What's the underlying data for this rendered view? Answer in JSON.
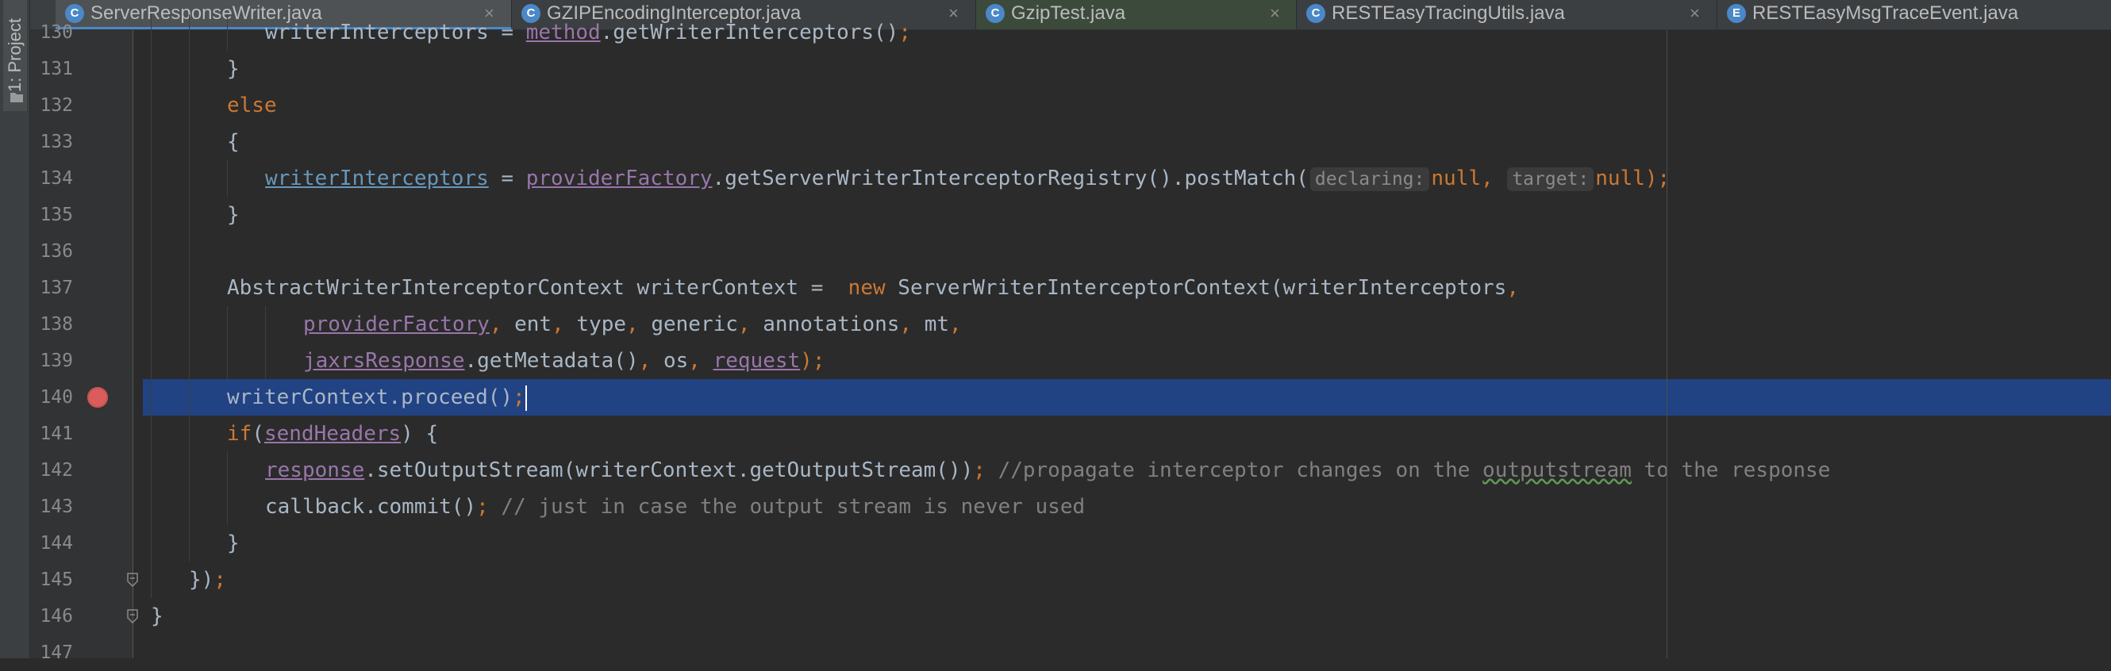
{
  "sidebar": {
    "project_label": "1: Project"
  },
  "tabs": [
    {
      "icon": "class-icon",
      "icon_letter": "C",
      "icon_color": "#4a88c7",
      "label": "ServerResponseWriter.java",
      "close": "×",
      "active": true
    },
    {
      "icon": "class-icon",
      "icon_letter": "C",
      "icon_color": "#4a88c7",
      "label": "GZIPEncodingInterceptor.java",
      "close": "×",
      "active": false
    },
    {
      "icon": "class-icon",
      "icon_letter": "C",
      "icon_color": "#4a88c7",
      "label": "GzipTest.java",
      "close": "×",
      "active": false
    },
    {
      "icon": "class-icon",
      "icon_letter": "C",
      "icon_color": "#4a88c7",
      "label": "RESTEasyTracingUtils.java",
      "close": "×",
      "active": false
    },
    {
      "icon": "enum-icon",
      "icon_letter": "E",
      "icon_color": "#4a88c7",
      "label": "RESTEasyMsgTraceEvent.java",
      "close": "",
      "active": false
    }
  ],
  "colors": {
    "background": "#2b2b2b",
    "selection": "#214283",
    "keyword": "#cc7832",
    "field": "#9876aa",
    "comment": "#808080",
    "breakpoint": "#db5c5c"
  },
  "editor": {
    "lines": [
      {
        "num": "130",
        "tokens": [
          {
            "t": "writerInterceptors = ",
            "c": "default"
          },
          {
            "t": "method",
            "c": "field"
          },
          {
            "t": ".getWriterInterceptors()",
            "c": "default"
          },
          {
            "t": ";",
            "c": "keyword"
          }
        ]
      },
      {
        "num": "131",
        "tokens": [
          {
            "t": "}",
            "c": "default"
          }
        ]
      },
      {
        "num": "132",
        "tokens": [
          {
            "t": "else",
            "c": "keyword"
          }
        ]
      },
      {
        "num": "133",
        "tokens": [
          {
            "t": "{",
            "c": "default"
          }
        ]
      },
      {
        "num": "134",
        "tokens": [
          {
            "t": "writerInterceptors",
            "c": "fieldblue"
          },
          {
            "t": " = ",
            "c": "default"
          },
          {
            "t": "providerFactory",
            "c": "field"
          },
          {
            "t": ".getServerWriterInterceptorRegistry().postMatch(",
            "c": "default"
          },
          {
            "t": "declaring:",
            "c": "hint"
          },
          {
            "t": "null",
            "c": "keyword"
          },
          {
            "t": ", ",
            "c": "keyword"
          },
          {
            "t": "target:",
            "c": "hint"
          },
          {
            "t": "null",
            "c": "keyword"
          },
          {
            "t": ");",
            "c": "keyword"
          }
        ]
      },
      {
        "num": "135",
        "tokens": [
          {
            "t": "}",
            "c": "default"
          }
        ]
      },
      {
        "num": "136",
        "tokens": []
      },
      {
        "num": "137",
        "tokens": [
          {
            "t": "AbstractWriterInterceptorContext writerContext =  ",
            "c": "default"
          },
          {
            "t": "new ",
            "c": "keyword"
          },
          {
            "t": "ServerWriterInterceptorContext(writerInterceptors",
            "c": "default"
          },
          {
            "t": ",",
            "c": "keyword"
          }
        ]
      },
      {
        "num": "138",
        "tokens": [
          {
            "t": "providerFactory",
            "c": "field"
          },
          {
            "t": ", ",
            "c": "keyword"
          },
          {
            "t": "ent",
            "c": "default"
          },
          {
            "t": ", ",
            "c": "keyword"
          },
          {
            "t": "type",
            "c": "default"
          },
          {
            "t": ", ",
            "c": "keyword"
          },
          {
            "t": "generic",
            "c": "default"
          },
          {
            "t": ", ",
            "c": "keyword"
          },
          {
            "t": "annotations",
            "c": "default"
          },
          {
            "t": ", ",
            "c": "keyword"
          },
          {
            "t": "mt",
            "c": "default"
          },
          {
            "t": ",",
            "c": "keyword"
          }
        ]
      },
      {
        "num": "139",
        "tokens": [
          {
            "t": "jaxrsResponse",
            "c": "field"
          },
          {
            "t": ".getMetadata()",
            "c": "default"
          },
          {
            "t": ", ",
            "c": "keyword"
          },
          {
            "t": "os",
            "c": "default"
          },
          {
            "t": ", ",
            "c": "keyword"
          },
          {
            "t": "request",
            "c": "field"
          },
          {
            "t": ");",
            "c": "keyword"
          }
        ]
      },
      {
        "num": "140",
        "tokens": [
          {
            "t": "writerContext.proceed()",
            "c": "default"
          },
          {
            "t": ";",
            "c": "keyword"
          }
        ]
      },
      {
        "num": "141",
        "tokens": [
          {
            "t": "if",
            "c": "keyword"
          },
          {
            "t": "(",
            "c": "default"
          },
          {
            "t": "sendHeaders",
            "c": "field"
          },
          {
            "t": ") {",
            "c": "default"
          }
        ]
      },
      {
        "num": "142",
        "tokens": [
          {
            "t": "response",
            "c": "field"
          },
          {
            "t": ".setOutputStream(writerContext.getOutputStream())",
            "c": "default"
          },
          {
            "t": "; ",
            "c": "keyword"
          },
          {
            "t": "//propagate interceptor changes on the ",
            "c": "comment"
          },
          {
            "t": "outputstream",
            "c": "squiggle"
          },
          {
            "t": " to the response",
            "c": "comment"
          }
        ]
      },
      {
        "num": "143",
        "tokens": [
          {
            "t": "callback.commit()",
            "c": "default"
          },
          {
            "t": "; ",
            "c": "keyword"
          },
          {
            "t": "// just in case the output stream is never used",
            "c": "comment"
          }
        ]
      },
      {
        "num": "144",
        "tokens": [
          {
            "t": "}",
            "c": "default"
          }
        ]
      },
      {
        "num": "145",
        "tokens": [
          {
            "t": "})",
            "c": "default"
          },
          {
            "t": ";",
            "c": "keyword"
          }
        ]
      },
      {
        "num": "146",
        "tokens": [
          {
            "t": "}",
            "c": "default"
          }
        ]
      },
      {
        "num": "147",
        "tokens": []
      }
    ]
  }
}
